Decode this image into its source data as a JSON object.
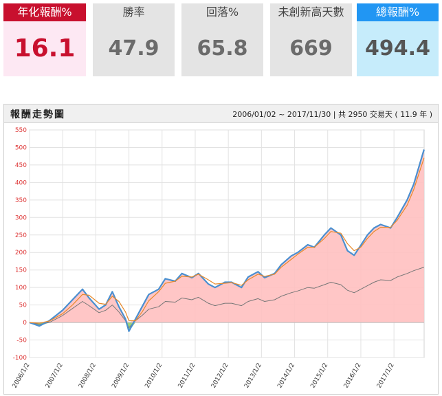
{
  "stats": [
    {
      "label": "年化報酬%",
      "value": "16.1"
    },
    {
      "label": "勝率",
      "value": "47.9"
    },
    {
      "label": "回落%",
      "value": "65.8"
    },
    {
      "label": "未創新高天數",
      "value": "669"
    },
    {
      "label": "總報酬%",
      "value": "494.4"
    }
  ],
  "panel": {
    "title": "報酬走勢圖",
    "range": "2006/01/02 ~ 2017/11/30 | 共 2950 交易天 ( 11.9 年 )"
  },
  "chart_data": {
    "type": "area",
    "x_range": [
      "2006/1/2",
      "2017/11/30"
    ],
    "x_tick_labels": [
      "2006/1/2",
      "2007/1/2",
      "2008/1/2",
      "2009/1/2",
      "2010/1/2",
      "2011/1/2",
      "2012/1/2",
      "2013/1/2",
      "2014/1/2",
      "2015/1/2",
      "2016/1/2",
      "2017/1/2"
    ],
    "y_ticks": [
      550,
      500,
      450,
      400,
      350,
      300,
      250,
      200,
      150,
      100,
      50,
      0,
      -50,
      -100
    ],
    "ylim": [
      -100,
      550
    ],
    "grid": true,
    "colors": {
      "strategy": "#4a8fd0",
      "moving_avg": "#e8892a",
      "benchmark": "#777777",
      "area_positive": "#ffc0c0",
      "area_negative": "#90d070"
    },
    "series": [
      {
        "key": "strategy",
        "x": [
          2006.0,
          2006.3,
          2006.6,
          2007.0,
          2007.3,
          2007.6,
          2007.8,
          2008.1,
          2008.3,
          2008.5,
          2008.7,
          2008.9,
          2009.0,
          2009.2,
          2009.4,
          2009.6,
          2009.9,
          2010.1,
          2010.4,
          2010.6,
          2010.9,
          2011.1,
          2011.4,
          2011.6,
          2011.9,
          2012.1,
          2012.4,
          2012.6,
          2012.9,
          2013.1,
          2013.4,
          2013.6,
          2013.9,
          2014.1,
          2014.4,
          2014.6,
          2014.9,
          2015.1,
          2015.4,
          2015.6,
          2015.8,
          2016.0,
          2016.2,
          2016.4,
          2016.6,
          2016.9,
          2017.1,
          2017.4,
          2017.6,
          2017.91
        ],
        "y": [
          0,
          -10,
          5,
          35,
          65,
          95,
          70,
          38,
          50,
          88,
          45,
          10,
          -25,
          10,
          45,
          80,
          95,
          125,
          118,
          140,
          128,
          140,
          110,
          100,
          115,
          115,
          100,
          130,
          145,
          128,
          140,
          165,
          190,
          200,
          222,
          215,
          250,
          270,
          250,
          205,
          192,
          220,
          250,
          270,
          280,
          270,
          300,
          350,
          395,
          494
        ]
      },
      {
        "key": "moving_avg",
        "x": [
          2006.0,
          2006.3,
          2006.6,
          2007.0,
          2007.3,
          2007.6,
          2007.8,
          2008.1,
          2008.3,
          2008.5,
          2008.7,
          2008.9,
          2009.0,
          2009.2,
          2009.4,
          2009.6,
          2009.9,
          2010.1,
          2010.4,
          2010.6,
          2010.9,
          2011.1,
          2011.4,
          2011.6,
          2011.9,
          2012.1,
          2012.4,
          2012.6,
          2012.9,
          2013.1,
          2013.4,
          2013.6,
          2013.9,
          2014.1,
          2014.4,
          2014.6,
          2014.9,
          2015.1,
          2015.4,
          2015.6,
          2015.8,
          2016.0,
          2016.2,
          2016.4,
          2016.6,
          2016.9,
          2017.1,
          2017.4,
          2017.6,
          2017.91
        ],
        "y": [
          0,
          -2,
          4,
          25,
          50,
          80,
          78,
          55,
          52,
          75,
          60,
          30,
          5,
          5,
          30,
          62,
          88,
          112,
          118,
          132,
          130,
          138,
          122,
          110,
          112,
          114,
          106,
          122,
          138,
          132,
          138,
          158,
          180,
          195,
          215,
          215,
          240,
          260,
          255,
          225,
          205,
          215,
          240,
          260,
          272,
          272,
          292,
          335,
          380,
          470
        ]
      },
      {
        "key": "benchmark",
        "x": [
          2006.0,
          2006.3,
          2006.6,
          2007.0,
          2007.3,
          2007.6,
          2007.8,
          2008.1,
          2008.3,
          2008.5,
          2008.7,
          2008.9,
          2009.0,
          2009.2,
          2009.4,
          2009.6,
          2009.9,
          2010.1,
          2010.4,
          2010.6,
          2010.9,
          2011.1,
          2011.4,
          2011.6,
          2011.9,
          2012.1,
          2012.4,
          2012.6,
          2012.9,
          2013.1,
          2013.4,
          2013.6,
          2013.9,
          2014.1,
          2014.4,
          2014.6,
          2014.9,
          2015.1,
          2015.4,
          2015.6,
          2015.8,
          2016.0,
          2016.2,
          2016.4,
          2016.6,
          2016.9,
          2017.1,
          2017.4,
          2017.6,
          2017.91
        ],
        "y": [
          0,
          -5,
          0,
          20,
          40,
          60,
          48,
          28,
          35,
          50,
          30,
          5,
          -15,
          5,
          20,
          38,
          45,
          60,
          58,
          70,
          65,
          72,
          55,
          48,
          55,
          55,
          48,
          60,
          68,
          60,
          65,
          75,
          85,
          90,
          100,
          98,
          108,
          115,
          108,
          92,
          85,
          95,
          105,
          115,
          122,
          120,
          130,
          140,
          148,
          158
        ]
      }
    ]
  }
}
